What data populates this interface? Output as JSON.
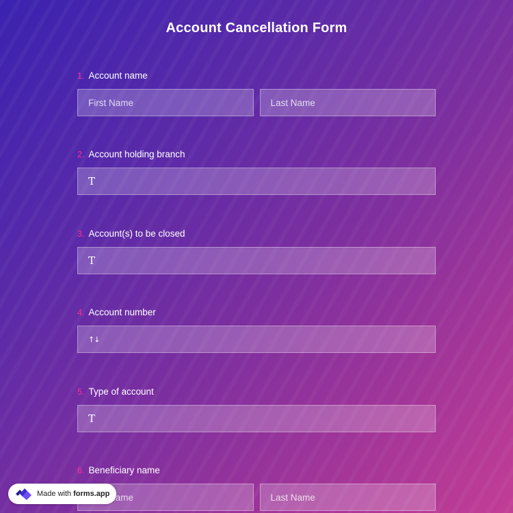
{
  "form": {
    "title": "Account Cancellation Form"
  },
  "questions": [
    {
      "number": "1.",
      "label": "Account name",
      "type": "name",
      "fields": [
        "First Name",
        "Last Name"
      ]
    },
    {
      "number": "2.",
      "label": "Account holding branch",
      "type": "text",
      "icon": "text-icon",
      "icon_glyph": "T"
    },
    {
      "number": "3.",
      "label": "Account(s) to be closed",
      "type": "text",
      "icon": "text-icon",
      "icon_glyph": "T"
    },
    {
      "number": "4.",
      "label": "Account number",
      "type": "number",
      "icon": "number-icon",
      "icon_glyph": "↑↓"
    },
    {
      "number": "5.",
      "label": "Type of account",
      "type": "text",
      "icon": "text-icon",
      "icon_glyph": "T"
    },
    {
      "number": "6.",
      "label": "Beneficiary name",
      "type": "name",
      "fields": [
        "First Name",
        "Last Name"
      ]
    }
  ],
  "badge": {
    "prefix": "Made with",
    "brand": "forms.app"
  },
  "colors": {
    "gradient_start": "#3a22b0",
    "gradient_end": "#c23d95",
    "question_number": "#ff2fa0",
    "field_background": "rgba(255,255,255,0.22)"
  }
}
